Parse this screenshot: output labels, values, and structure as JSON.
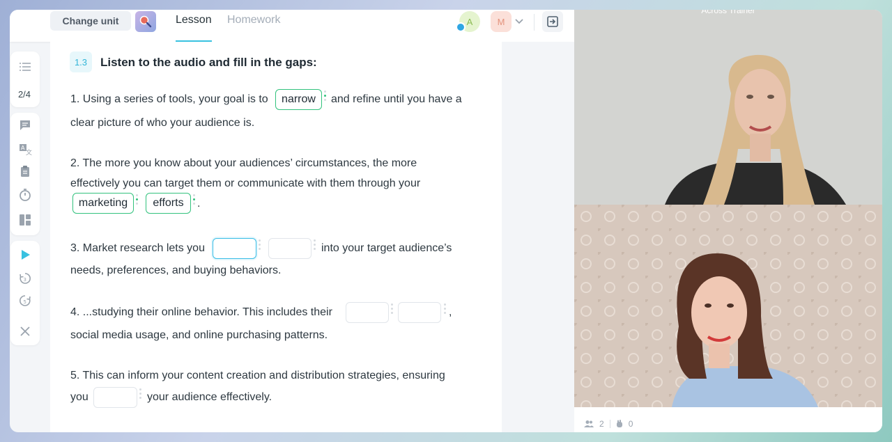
{
  "header": {
    "change_unit": "Change unit",
    "tabs": [
      {
        "label": "Lesson",
        "active": true
      },
      {
        "label": "Homework",
        "active": false
      }
    ],
    "avatars": [
      {
        "initial": "A",
        "color": "#e5f4cf"
      },
      {
        "initial": "M",
        "color": "#fbe0d9"
      }
    ]
  },
  "sidebar": {
    "page_indicator": "2/4",
    "tools_top": [
      "list-icon"
    ],
    "tools_middle": [
      "chat-icon",
      "translate-icon",
      "clipboard-icon",
      "timer-icon",
      "layout-icon"
    ],
    "tools_bottom": [
      "play-icon",
      "replay-3-icon",
      "forward-5-icon",
      "close-icon"
    ]
  },
  "exercise": {
    "number": "1.3",
    "title": "Listen to the audio and fill in the gaps:",
    "q1": {
      "a": "1. Using a series of tools, your goal is to",
      "gap1": "narrow",
      "b": "and refine until you have a",
      "c": "clear picture of who your audience is."
    },
    "q2": {
      "a": "2. The more you know about your audiences’ circumstances, the more",
      "b": "effectively you can target them or communicate with them through your",
      "gap1": "marketing",
      "gap2": "efforts",
      "end": "."
    },
    "q3": {
      "a": "3. Market research lets you",
      "b": "into your target audience’s",
      "c": "needs, preferences, and buying behaviors."
    },
    "q4": {
      "a": "4. ...studying their online behavior. This includes their",
      "comma": ",",
      "c": "social media usage, and online purchasing patterns."
    },
    "q5": {
      "a": "5. This can inform your content creation and distribution strategies, ensuring",
      "b": "you",
      "c": "your audience effectively."
    }
  },
  "video": {
    "participant_1": "Across Trainer",
    "participants_count": "2",
    "hands_count": "0"
  },
  "colors": {
    "accent": "#38c1e0",
    "correct": "#32c27d"
  }
}
